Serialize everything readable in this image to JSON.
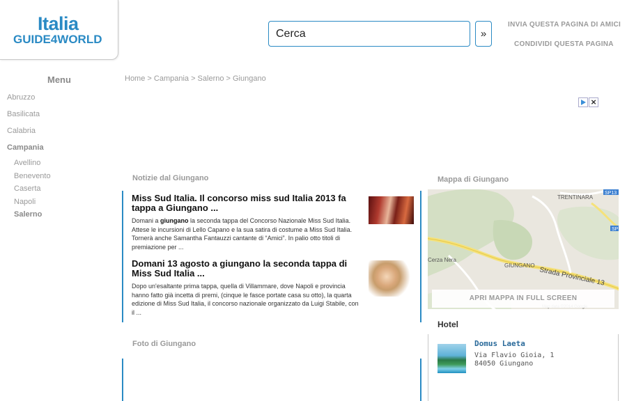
{
  "logo": {
    "line1": "Italia",
    "line2": "GUIDE4WORLD"
  },
  "search": {
    "value": "Cerca",
    "button_label": "»"
  },
  "top_links": {
    "invite": "INVIA QUESTA PAGINA DI AMICI",
    "share": "CONDIVIDI QUESTA PAGINA"
  },
  "menu": {
    "title": "Menu",
    "regions": [
      "Abruzzo",
      "Basilicata",
      "Calabria"
    ],
    "active_region": "Campania",
    "provinces": [
      "Avellino",
      "Benevento",
      "Caserta",
      "Napoli"
    ],
    "active_province": "Salerno"
  },
  "breadcrumb": "Home > Campania > Salerno > Giungano",
  "ad": {
    "close_label": "×"
  },
  "news": {
    "title": "Notizie dal Giungano",
    "items": [
      {
        "title": "Miss Sud Italia. Il concorso miss sud Italia 2013 fa tappa a Giungano ...",
        "text_before": "Domani a ",
        "text_bold": "giungano",
        "text_after": " la seconda tappa del Concorso Nazionale Miss Sud Italia. Attese le incursioni di Lello Capano e la sua satira di costume a Miss Sud Italia. Tornerà anche Samantha Fantauzzi cantante di “Amici”. In palio otto titoli di premiazione per ..."
      },
      {
        "title": "Domani 13 agosto a giungano la seconda tappa di Miss Sud Italia ...",
        "text_before": "Dopo un'esaltante prima tappa, quella di Villammare, dove Napoli e provincia hanno fatto già incetta di premi, (cinque le fasce portate casa su otto), la quarta edizione di Miss Sud Italia, il concorso nazionale organizzato da Luigi Stabile, con il ...",
        "text_bold": "",
        "text_after": ""
      }
    ]
  },
  "photos": {
    "title": "Foto di Giungano"
  },
  "map": {
    "title": "Mappa di Giungano",
    "labels": {
      "trentinara": "TRENTINARA",
      "giungano": "GIUNGANO",
      "cerza": "Cerza Nera",
      "road": "Strada Provinciale 13",
      "sp1": "SP13",
      "sp2": "SP",
      "credits": "Map data ©2014 Google"
    },
    "fullscreen_label": "APRI MAPPA IN FULL SCREEN"
  },
  "hotel": {
    "title": "Hotel",
    "name": "Domus Laeta",
    "address_line1": "Via Flavio Gioia, 1",
    "address_line2": "84050 Giungano"
  }
}
